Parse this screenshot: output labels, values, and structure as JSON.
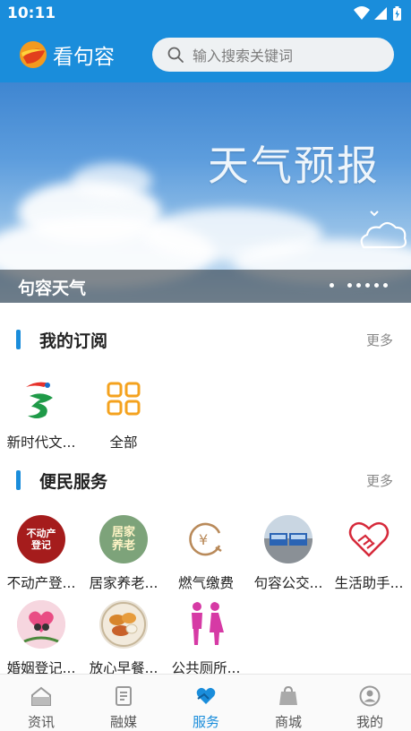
{
  "status_bar": {
    "time": "10:11"
  },
  "app_bar": {
    "brand_name": "看句容",
    "search_placeholder": "输入搜索关键词"
  },
  "banner": {
    "headline": "天气预报",
    "caption": "句容天气",
    "slide_count": 6,
    "active_slide": 1
  },
  "subscriptions": {
    "title": "我的订阅",
    "more": "更多",
    "items": [
      {
        "label": "新时代文...",
        "icon": "new-era-logo-icon"
      },
      {
        "label": "全部",
        "icon": "grid-icon"
      }
    ]
  },
  "services": {
    "title": "便民服务",
    "more": "更多",
    "items": [
      {
        "label": "不动产登...",
        "icon": "property-registration-icon",
        "icon_text": "不动产登记",
        "color": "#a51c1c"
      },
      {
        "label": "居家养老...",
        "icon": "elderly-care-icon",
        "icon_text": "居家养老",
        "color": "#7da37a"
      },
      {
        "label": "燃气缴费",
        "icon": "gas-payment-icon",
        "color": "#b98a5a"
      },
      {
        "label": "句容公交...",
        "icon": "bus-icon"
      },
      {
        "label": "生活助手...",
        "icon": "handshake-heart-icon",
        "color": "#d6293a"
      },
      {
        "label": "婚姻登记...",
        "icon": "marriage-registration-icon"
      },
      {
        "label": "放心早餐...",
        "icon": "breakfast-icon"
      },
      {
        "label": "公共厕所...",
        "icon": "restroom-icon",
        "color": "#d63aa5"
      }
    ]
  },
  "tabbar": {
    "active": "服务",
    "items": [
      {
        "label": "资讯",
        "icon": "home-icon"
      },
      {
        "label": "融媒",
        "icon": "document-icon"
      },
      {
        "label": "服务",
        "icon": "service-heart-icon"
      },
      {
        "label": "商城",
        "icon": "shop-bag-icon"
      },
      {
        "label": "我的",
        "icon": "profile-icon"
      }
    ]
  },
  "colors": {
    "primary": "#1a8ddb",
    "text": "#222222",
    "muted": "#888888"
  }
}
